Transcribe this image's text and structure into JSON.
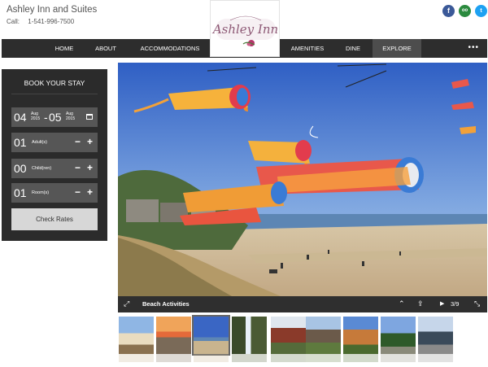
{
  "header": {
    "hotel_name": "Ashley Inn and Suites",
    "call_label": "Call:",
    "phone": "1-541-996-7500",
    "logo_alt": "Ashley Inn",
    "social": [
      "facebook-icon",
      "tripadvisor-icon",
      "twitter-icon"
    ]
  },
  "nav": {
    "items": [
      "HOME",
      "ABOUT",
      "ACCOMMODATIONS",
      "AMENITIES",
      "DINE",
      "EXPLORE"
    ],
    "active": "EXPLORE",
    "more": "•••"
  },
  "booking": {
    "title": "BOOK YOUR STAY",
    "checkin_day": "04",
    "checkin_month": "Aug",
    "checkin_year": "2015",
    "separator": "-",
    "checkout_day": "05",
    "checkout_month": "Aug",
    "checkout_year": "2015",
    "adults_value": "01",
    "adults_label": "Adult(s)",
    "children_value": "00",
    "children_label": "Child(ren)",
    "rooms_value": "01",
    "rooms_label": "Room(s)",
    "minus": "−",
    "plus": "+",
    "check_rates": "Check Rates"
  },
  "gallery": {
    "caption": "Beach Activities",
    "counter": "3/9",
    "play": "▶",
    "thumb_count": 9,
    "selected_index": 3
  },
  "colors": {
    "nav_bg": "#2d2d2d",
    "nav_active": "#4d4d4d",
    "panel_bg": "#2b2b2b",
    "field_bg": "#565656",
    "button_bg": "#d7d7d7"
  }
}
